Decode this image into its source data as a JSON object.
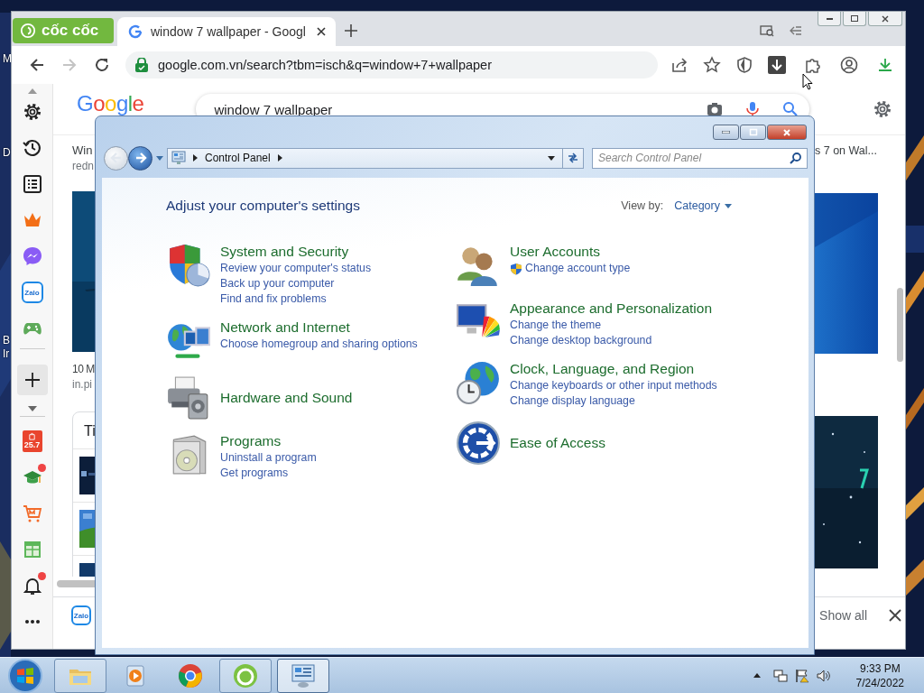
{
  "desktop": {
    "labels": [
      "M",
      "D",
      "B",
      "Ir"
    ]
  },
  "browser": {
    "brand": "cốc cốc",
    "tab_title": "window 7 wallpaper - Googl",
    "nav": [
      {
        "kind": "back",
        "disabled": false
      },
      {
        "kind": "forward",
        "disabled": true
      },
      {
        "kind": "reload",
        "disabled": false
      }
    ],
    "url": "google.com.vn/search?tbm=isch&q=window+7+wallpaper",
    "sidebar": {
      "top": [
        {
          "kind": "settings"
        },
        {
          "kind": "history"
        },
        {
          "kind": "list"
        },
        {
          "kind": "crown"
        },
        {
          "kind": "messenger"
        },
        {
          "kind": "zalo",
          "label": "Zalo"
        },
        {
          "kind": "games"
        }
      ],
      "apps": [
        {
          "kind": "shop",
          "label": "25.7",
          "badge": false
        },
        {
          "kind": "school",
          "badge": true
        },
        {
          "kind": "cart",
          "badge": false
        },
        {
          "kind": "sheet",
          "badge": false
        },
        {
          "kind": "bell",
          "badge": true
        }
      ]
    },
    "page": {
      "logo": "Google",
      "query": "window 7 wallpaper",
      "left_results": [
        {
          "title": "Win",
          "source": "redn"
        },
        {
          "title": "10 M",
          "source": "in.pi"
        }
      ],
      "card_title": "Ti",
      "right_result": {
        "title": "s 7 on Wal..."
      },
      "downloads": {
        "app_label": "Zalo",
        "action": "Show all"
      }
    }
  },
  "control_panel": {
    "nav": [
      {
        "kind": "back",
        "disabled": true
      },
      {
        "kind": "forward",
        "disabled": false
      }
    ],
    "breadcrumb": "Control Panel",
    "search_placeholder": "Search Control Panel",
    "heading": "Adjust your computer's settings",
    "view_by_label": "View by:",
    "view_by_value": "Category",
    "columns": [
      [
        {
          "kind": "security",
          "title": "System and Security",
          "links": [
            {
              "text": "Review your computer's status",
              "shield": false
            },
            {
              "text": "Back up your computer",
              "shield": false
            },
            {
              "text": "Find and fix problems",
              "shield": false
            }
          ]
        },
        {
          "kind": "network",
          "title": "Network and Internet",
          "links": [
            {
              "text": "Choose homegroup and sharing options",
              "shield": false
            }
          ]
        },
        {
          "kind": "hardware",
          "title": "Hardware and Sound"
        },
        {
          "kind": "programs",
          "title": "Programs",
          "links": [
            {
              "text": "Uninstall a program",
              "shield": false
            },
            {
              "text": "Get programs",
              "shield": false
            }
          ]
        }
      ],
      [
        {
          "kind": "users",
          "title": "User Accounts",
          "links": [
            {
              "text": "Change account type",
              "shield": true
            }
          ]
        },
        {
          "kind": "appearance",
          "title": "Appearance and Personalization",
          "links": [
            {
              "text": "Change the theme",
              "shield": false
            },
            {
              "text": "Change desktop background",
              "shield": false
            }
          ]
        },
        {
          "kind": "clock",
          "title": "Clock, Language, and Region",
          "links": [
            {
              "text": "Change keyboards or other input methods",
              "shield": false
            },
            {
              "text": "Change display language",
              "shield": false
            }
          ]
        },
        {
          "kind": "access",
          "title": "Ease of Access"
        }
      ]
    ]
  },
  "taskbar": {
    "apps": [
      {
        "kind": "explorer",
        "running": true,
        "selected": false
      },
      {
        "kind": "media",
        "running": false,
        "selected": false
      },
      {
        "kind": "chrome",
        "running": false,
        "selected": false
      },
      {
        "kind": "coccoc",
        "running": true,
        "selected": false
      },
      {
        "kind": "control-panel",
        "running": true,
        "selected": true
      }
    ],
    "time": "9:33 PM",
    "date": "7/24/2022"
  }
}
